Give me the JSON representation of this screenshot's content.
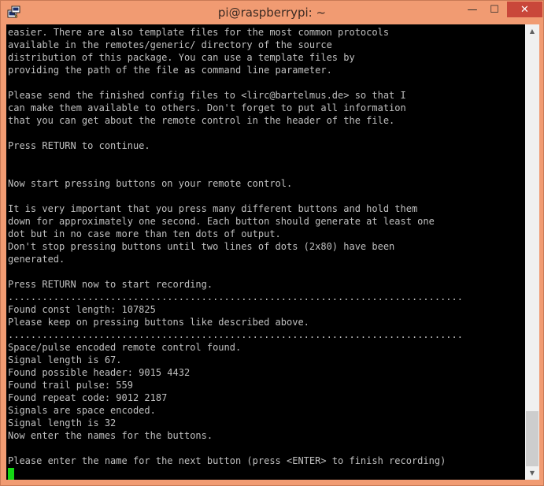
{
  "window": {
    "title": "pi@raspberrypi: ~",
    "controls": {
      "minimize": "—",
      "maximize": "☐",
      "close": "✕"
    }
  },
  "terminal": {
    "lines": [
      "easier. There are also template files for the most common protocols",
      "available in the remotes/generic/ directory of the source",
      "distribution of this package. You can use a template files by",
      "providing the path of the file as command line parameter.",
      "",
      "Please send the finished config files to <lirc@bartelmus.de> so that I",
      "can make them available to others. Don't forget to put all information",
      "that you can get about the remote control in the header of the file.",
      "",
      "Press RETURN to continue.",
      "",
      "",
      "Now start pressing buttons on your remote control.",
      "",
      "It is very important that you press many different buttons and hold them",
      "down for approximately one second. Each button should generate at least one",
      "dot but in no case more than ten dots of output.",
      "Don't stop pressing buttons until two lines of dots (2x80) have been",
      "generated.",
      "",
      "Press RETURN now to start recording.",
      "................................................................................",
      "Found const length: 107825",
      "Please keep on pressing buttons like described above.",
      "................................................................................",
      "Space/pulse encoded remote control found.",
      "Signal length is 67.",
      "Found possible header: 9015 4432",
      "Found trail pulse: 559",
      "Found repeat code: 9012 2187",
      "Signals are space encoded.",
      "Signal length is 32",
      "Now enter the names for the buttons.",
      "",
      "Please enter the name for the next button (press <ENTER> to finish recording)"
    ],
    "cursor_color": "#14d814"
  },
  "icons": {
    "app": "putty-icon",
    "scroll_up": "scroll-up-arrow-icon",
    "scroll_down": "scroll-down-arrow-icon"
  }
}
